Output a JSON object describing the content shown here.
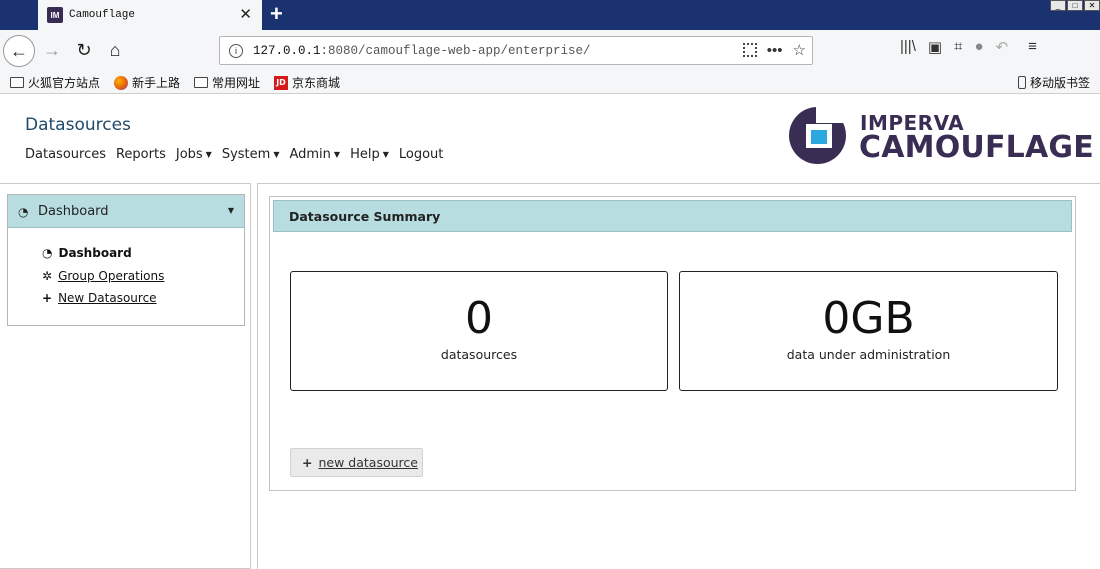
{
  "browser": {
    "tab_title": "Camouflage",
    "tab_favicon": "IM",
    "url_host": "127.0.0.1",
    "url_rest": ":8080/camouflage-web-app/enterprise/",
    "bookmarks": [
      {
        "label": "火狐官方站点"
      },
      {
        "label": "新手上路"
      },
      {
        "label": "常用网址"
      },
      {
        "label": "京东商城"
      }
    ],
    "mobile_bookmarks": "移动版书签"
  },
  "header": {
    "page_title": "Datasources",
    "menu": [
      {
        "label": "Datasources",
        "dropdown": false
      },
      {
        "label": "Reports",
        "dropdown": false
      },
      {
        "label": "Jobs",
        "dropdown": true
      },
      {
        "label": "System",
        "dropdown": true
      },
      {
        "label": "Admin",
        "dropdown": true
      },
      {
        "label": "Help",
        "dropdown": true
      },
      {
        "label": "Logout",
        "dropdown": false
      }
    ],
    "logo_brand": "IMPERVA",
    "logo_product": "CAMOUFLAGE",
    "logo_colors": {
      "primary": "#3a2d54",
      "accent": "#2aa8e0"
    }
  },
  "sidebar": {
    "header": "Dashboard",
    "items": [
      {
        "label": "Dashboard",
        "icon": "gauge-icon",
        "active": true
      },
      {
        "label": "Group Operations",
        "icon": "cogs-icon",
        "active": false
      },
      {
        "label": "New Datasource",
        "icon": "plus-icon",
        "active": false
      }
    ]
  },
  "summary": {
    "title": "Datasource Summary",
    "cards": [
      {
        "value": "0",
        "label": "datasources"
      },
      {
        "value": "0GB",
        "label": "data under administration"
      }
    ],
    "new_button": "new datasource"
  },
  "colors": {
    "panel_header": "#b8dde0",
    "title": "#1e4a6a"
  }
}
